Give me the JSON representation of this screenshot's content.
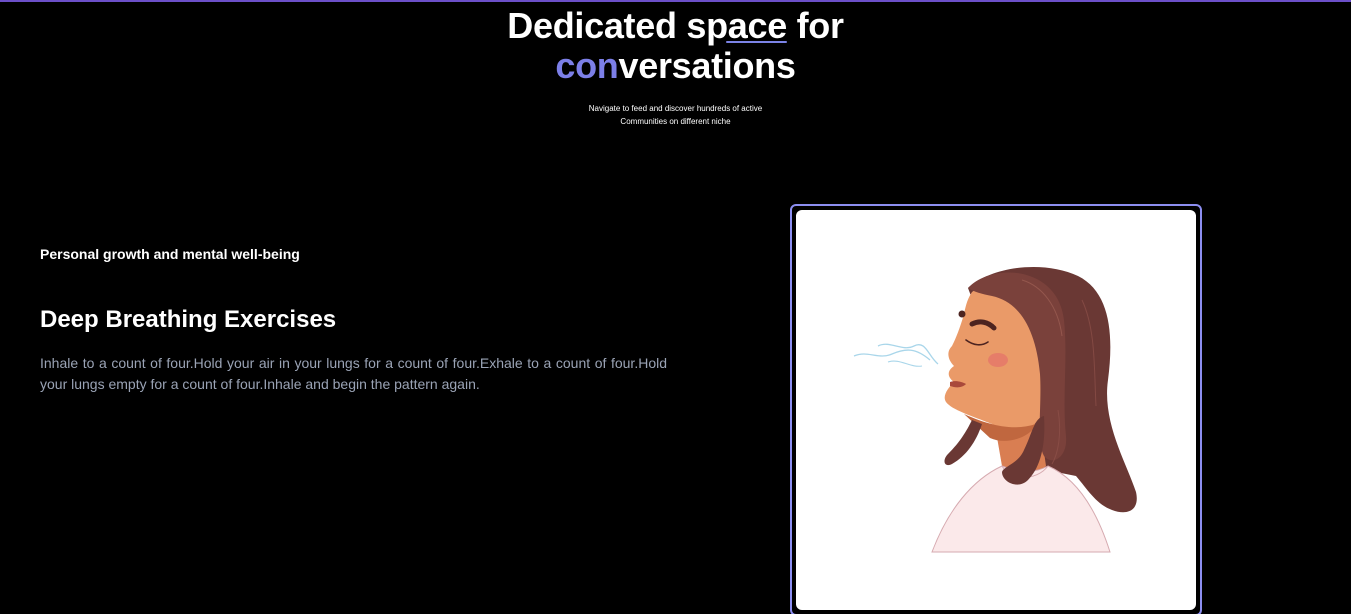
{
  "hero": {
    "title_line1_a": "Dedicated ",
    "title_line1_b": "space",
    "title_line1_c": " for",
    "title_line2_accent": "con",
    "title_line2_rest": "versations",
    "subtitle_line1": "Navigate to feed and discover hundreds of active",
    "subtitle_line2": "Communities on different niche"
  },
  "feature": {
    "eyebrow": "Personal growth and mental well-being",
    "title": "Deep Breathing Exercises",
    "body": "Inhale to a count of four.Hold your air in your lungs for a count of four.Exhale to a count of four.Hold your lungs empty for a count of four.Inhale and begin the pattern again."
  },
  "illustration": {
    "icon": "woman-breathing-illustration"
  },
  "colors": {
    "background": "#000000",
    "accent": "#7c7fe8",
    "frame_border": "#8c8ef0",
    "body_text": "#9aa3b5"
  }
}
